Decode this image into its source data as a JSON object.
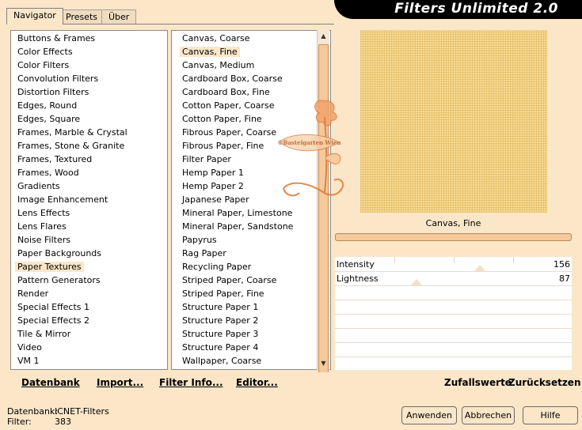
{
  "app_title": "Filters Unlimited 2.0",
  "tabs": [
    "Navigator",
    "Presets",
    "Über"
  ],
  "categories": [
    "Buttons & Frames",
    "Color Effects",
    "Color Filters",
    "Convolution Filters",
    "Distortion Filters",
    "Edges, Round",
    "Edges, Square",
    "Frames, Marble & Crystal",
    "Frames, Stone & Granite",
    "Frames, Textured",
    "Frames, Wood",
    "Gradients",
    "Image Enhancement",
    "Lens Effects",
    "Lens Flares",
    "Noise Filters",
    "Paper Backgrounds",
    "Paper Textures",
    "Pattern Generators",
    "Render",
    "Special Effects 1",
    "Special Effects 2",
    "Tile & Mirror",
    "Video",
    "VM 1"
  ],
  "selected_category": "Paper Textures",
  "filters": [
    "Canvas, Coarse",
    "Canvas, Fine",
    "Canvas, Medium",
    "Cardboard Box, Coarse",
    "Cardboard Box, Fine",
    "Cotton Paper, Coarse",
    "Cotton Paper, Fine",
    "Fibrous Paper, Coarse",
    "Fibrous Paper, Fine",
    "Filter Paper",
    "Hemp Paper 1",
    "Hemp Paper 2",
    "Japanese Paper",
    "Mineral Paper, Limestone",
    "Mineral Paper, Sandstone",
    "Papyrus",
    "Rag Paper",
    "Recycling Paper",
    "Striped Paper, Coarse",
    "Striped Paper, Fine",
    "Structure Paper 1",
    "Structure Paper 2",
    "Structure Paper 3",
    "Structure Paper 4",
    "Wallpaper, Coarse"
  ],
  "selected_filter": "Canvas, Fine",
  "filter_name_display": "Canvas, Fine",
  "sliders": [
    {
      "name": "Intensity",
      "value": "156"
    },
    {
      "name": "Lightness",
      "value": "87"
    }
  ],
  "buttons_left": [
    "Datenbank",
    "Import...",
    "Filter Info...",
    "Editor..."
  ],
  "buttons_right": [
    "Zufallswerte",
    "Zurücksetzen"
  ],
  "status": {
    "db_label": "Datenbank:",
    "db_value": "ICNET-Filters",
    "filter_label": "Filter:",
    "filter_value": "383"
  },
  "dialog_buttons": [
    "Anwenden",
    "Abbrechen",
    "Hilfe"
  ],
  "watermark_text": "©Bastelgarten Wien",
  "colors": {
    "background": "#fbe6c8",
    "accent": "#f6c89a",
    "preview": "#f6d98e"
  }
}
